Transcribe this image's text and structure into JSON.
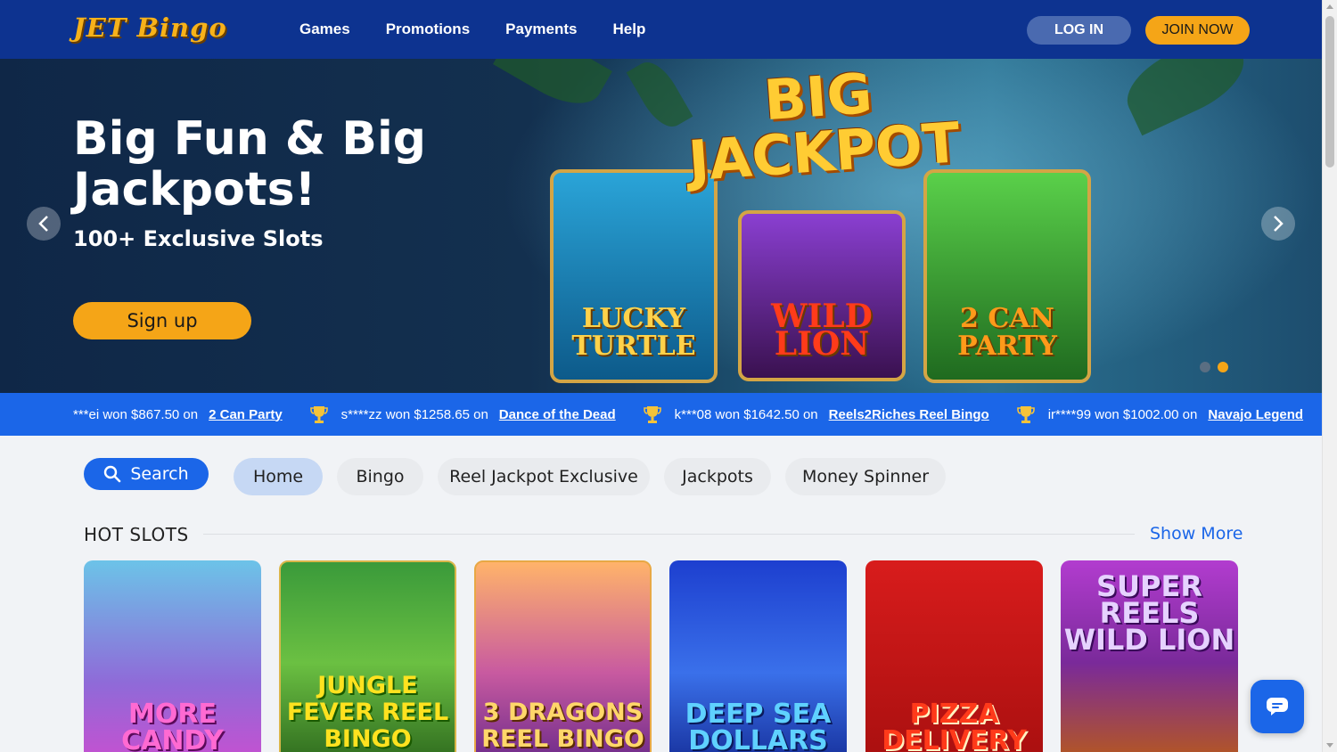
{
  "header": {
    "logo": "JET Bingo",
    "nav": [
      "Games",
      "Promotions",
      "Payments",
      "Help"
    ],
    "login_label": "LOG IN",
    "join_label": "JOIN NOW"
  },
  "hero": {
    "title": "Big Fun & Big Jackpots!",
    "subtitle": "100+ Exclusive Slots",
    "signup_label": "Sign up",
    "banner_heading_1": "BIG",
    "banner_heading_2": "JACKPOT",
    "games": [
      "LUCKY TURTLE",
      "WILD LION",
      "2 CAN PARTY"
    ],
    "slide_count": 2,
    "active_slide": 2
  },
  "ticker": {
    "items": [
      {
        "text": "***ei won $867.50 on",
        "game": "2 Can Party"
      },
      {
        "text": "s****zz won $1258.65 on",
        "game": "Dance of the Dead"
      },
      {
        "text": "k***08 won $1642.50 on",
        "game": "Reels2Riches Reel Bingo"
      },
      {
        "text": "ir****99 won $1002.00 on",
        "game": "Navajo Legend"
      }
    ]
  },
  "filters": {
    "search_label": "Search",
    "tabs": [
      "Home",
      "Bingo",
      "Reel Jackpot Exclusive",
      "Jackpots",
      "Money Spinner"
    ],
    "active_tab": "Home"
  },
  "section": {
    "title": "HOT SLOTS",
    "show_more": "Show More",
    "tiles": [
      "MORE CANDY",
      "JUNGLE FEVER REEL BINGO",
      "3 DRAGONS REEL BINGO",
      "DEEP SEA DOLLARS",
      "PIZZA DELIVERY",
      "SUPER REELS WILD LION"
    ]
  },
  "colors": {
    "header_bg": "#0d3390",
    "accent_orange": "#f5a517",
    "accent_blue": "#1b66e8"
  },
  "icons": {
    "search": "search-icon",
    "trophy": "trophy-icon",
    "chat": "chat-icon",
    "arrow_left": "chevron-left-icon",
    "arrow_right": "chevron-right-icon"
  }
}
